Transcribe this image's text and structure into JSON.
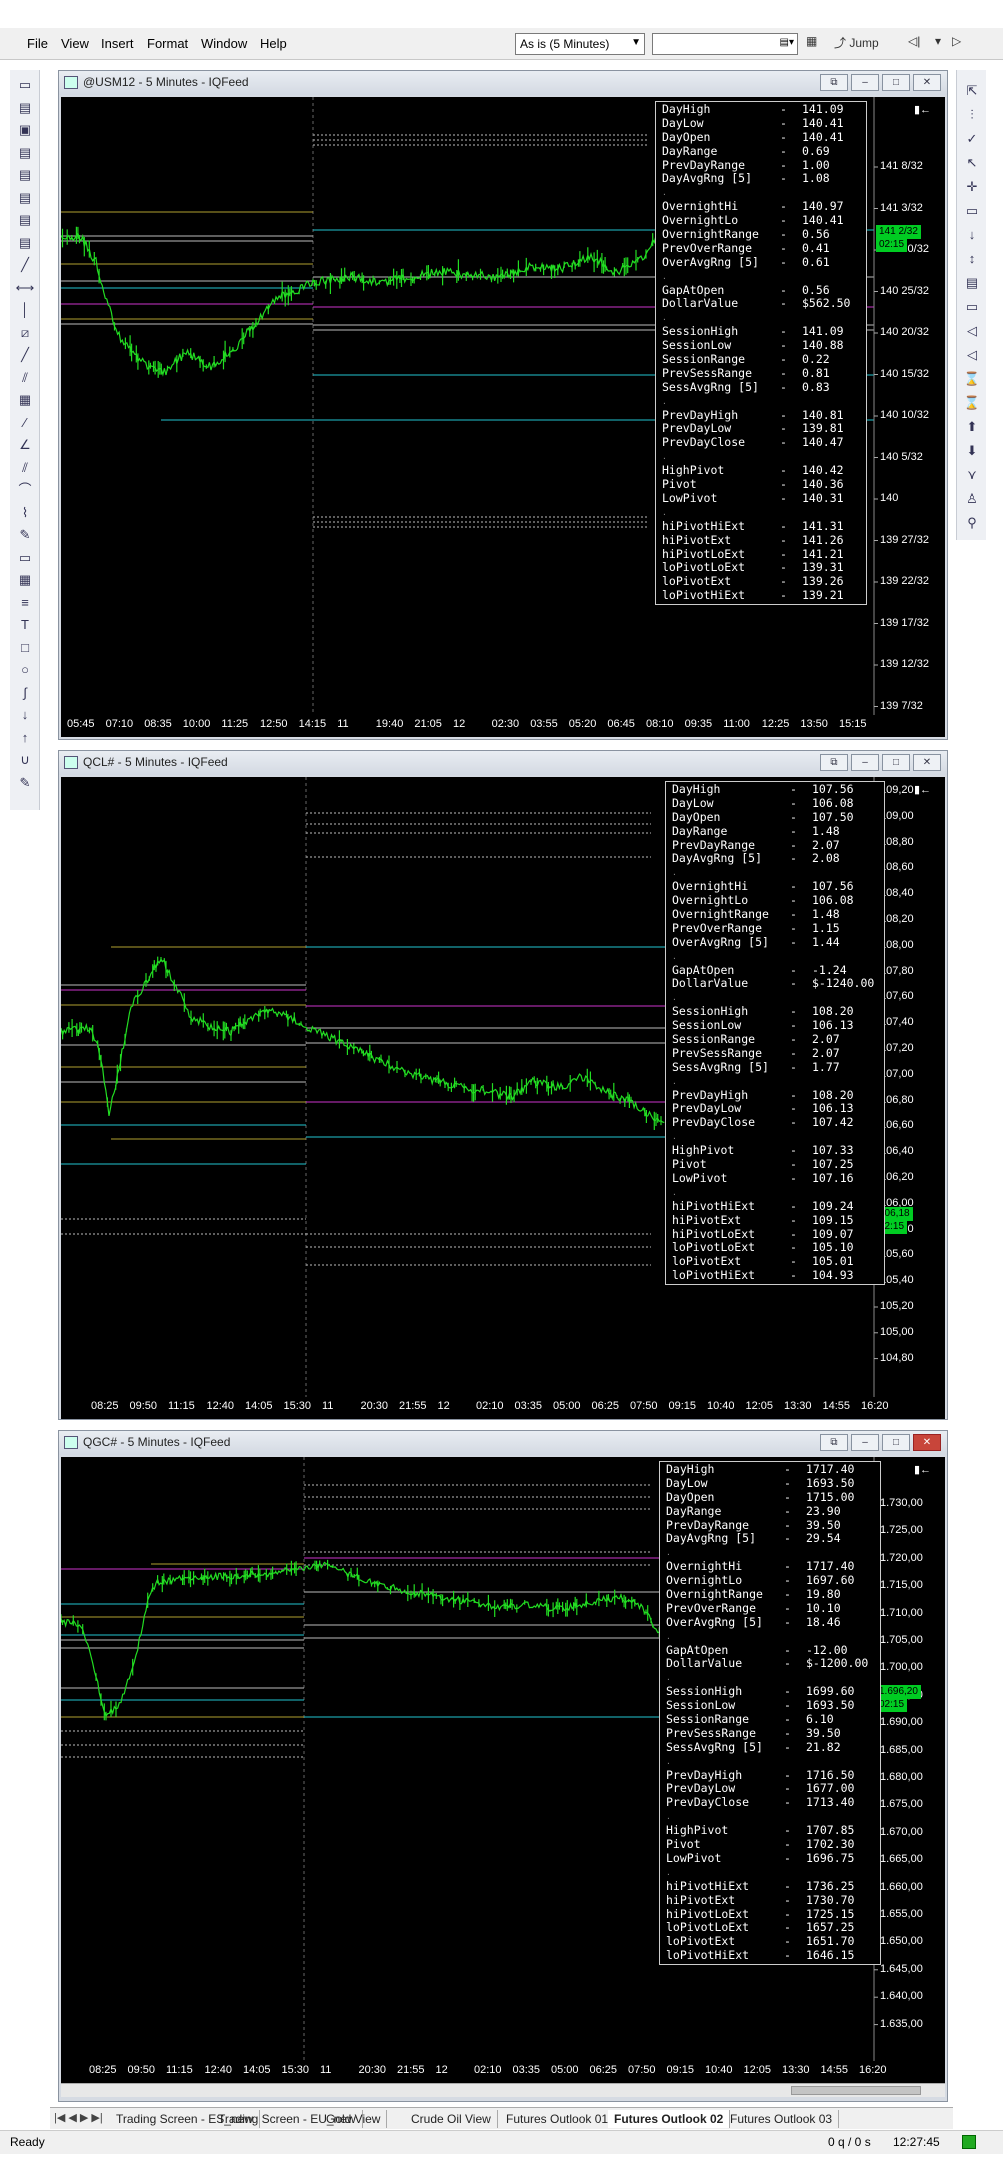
{
  "menu": {
    "items": [
      "File",
      "View",
      "Insert",
      "Format",
      "Window",
      "Help"
    ],
    "interval_select": "As is (5 Minutes)",
    "search_value": "",
    "jump_label": "Jump"
  },
  "charts": [
    {
      "title": "@USM12 - 5 Minutes - IQFeed",
      "x_ticks": [
        "05:45",
        "07:10",
        "08:35",
        "10:00",
        "11:25",
        "12:50",
        "14:15",
        "11",
        "19:40",
        "21:05",
        "12",
        "02:30",
        "03:55",
        "05:20",
        "06:45",
        "08:10",
        "09:35",
        "11:00",
        "12:25",
        "13:50",
        "15:15"
      ],
      "y_ticks": [
        "141 8/32",
        "141 3/32",
        "140 30/32",
        "140 25/32",
        "140 20/32",
        "140 15/32",
        "140 10/32",
        "140 5/32",
        "140",
        "139 27/32",
        "139 22/32",
        "139 17/32",
        "139 12/32",
        "139 7/32"
      ],
      "price_tags": [
        "141 2/32",
        "02:15"
      ],
      "stats": [
        [
          "DayHigh",
          "141.09"
        ],
        [
          "DayLow",
          "140.41"
        ],
        [
          "DayOpen",
          "140.41"
        ],
        [
          "DayRange",
          "0.69"
        ],
        [
          "PrevDayRange",
          "1.00"
        ],
        [
          "DayAvgRng [5]",
          "1.08"
        ],
        null,
        [
          "OvernightHi",
          "140.97"
        ],
        [
          "OvernightLo",
          "140.41"
        ],
        [
          "OvernightRange",
          "0.56"
        ],
        [
          "PrevOverRange",
          "0.41"
        ],
        [
          "OverAvgRng [5]",
          "0.61"
        ],
        null,
        [
          "GapAtOpen",
          "0.56"
        ],
        [
          "DollarValue",
          "$562.50"
        ],
        null,
        [
          "SessionHigh",
          "141.09"
        ],
        [
          "SessionLow",
          "140.88"
        ],
        [
          "SessionRange",
          "0.22"
        ],
        [
          "PrevSessRange",
          "0.81"
        ],
        [
          "SessAvgRng [5]",
          "0.83"
        ],
        null,
        [
          "PrevDayHigh",
          "140.81"
        ],
        [
          "PrevDayLow",
          "139.81"
        ],
        [
          "PrevDayClose",
          "140.47"
        ],
        null,
        [
          "HighPivot",
          "140.42"
        ],
        [
          "Pivot",
          "140.36"
        ],
        [
          "LowPivot",
          "140.31"
        ],
        null,
        [
          "hiPivotHiExt",
          "141.31"
        ],
        [
          "hiPivotExt",
          "141.26"
        ],
        [
          "hiPivotLoExt",
          "141.21"
        ],
        [
          "loPivotLoExt",
          "139.31"
        ],
        [
          "loPivotExt",
          "139.26"
        ],
        [
          "loPivotHiExt",
          "139.21"
        ]
      ]
    },
    {
      "title": "QCL# - 5 Minutes - IQFeed",
      "x_ticks": [
        "08:25",
        "09:50",
        "11:15",
        "12:40",
        "14:05",
        "15:30",
        "11",
        "20:30",
        "21:55",
        "12",
        "02:10",
        "03:35",
        "05:00",
        "06:25",
        "07:50",
        "09:15",
        "10:40",
        "12:05",
        "13:30",
        "14:55",
        "16:20"
      ],
      "y_ticks": [
        "109,20",
        "109,00",
        "108,80",
        "108,60",
        "108,40",
        "108,20",
        "108,00",
        "107,80",
        "107,60",
        "107,40",
        "107,20",
        "107,00",
        "106,80",
        "106,60",
        "106,40",
        "106,20",
        "106,00",
        "105,80",
        "105,60",
        "105,40",
        "105,20",
        "105,00",
        "104,80"
      ],
      "price_tags": [
        "106,18",
        "02:15"
      ],
      "stats": [
        [
          "DayHigh",
          "107.56"
        ],
        [
          "DayLow",
          "106.08"
        ],
        [
          "DayOpen",
          "107.50"
        ],
        [
          "DayRange",
          "1.48"
        ],
        [
          "PrevDayRange",
          "2.07"
        ],
        [
          "DayAvgRng [5]",
          "2.08"
        ],
        null,
        [
          "OvernightHi",
          "107.56"
        ],
        [
          "OvernightLo",
          "106.08"
        ],
        [
          "OvernightRange",
          "1.48"
        ],
        [
          "PrevOverRange",
          "1.15"
        ],
        [
          "OverAvgRng [5]",
          "1.44"
        ],
        null,
        [
          "GapAtOpen",
          "-1.24"
        ],
        [
          "DollarValue",
          "$-1240.00"
        ],
        null,
        [
          "SessionHigh",
          "108.20"
        ],
        [
          "SessionLow",
          "106.13"
        ],
        [
          "SessionRange",
          "2.07"
        ],
        [
          "PrevSessRange",
          "2.07"
        ],
        [
          "SessAvgRng [5]",
          "1.77"
        ],
        null,
        [
          "PrevDayHigh",
          "108.20"
        ],
        [
          "PrevDayLow",
          "106.13"
        ],
        [
          "PrevDayClose",
          "107.42"
        ],
        null,
        [
          "HighPivot",
          "107.33"
        ],
        [
          "Pivot",
          "107.25"
        ],
        [
          "LowPivot",
          "107.16"
        ],
        null,
        [
          "hiPivotHiExt",
          "109.24"
        ],
        [
          "hiPivotExt",
          "109.15"
        ],
        [
          "hiPivotLoExt",
          "109.07"
        ],
        [
          "loPivotLoExt",
          "105.10"
        ],
        [
          "loPivotExt",
          "105.01"
        ],
        [
          "loPivotHiExt",
          "104.93"
        ]
      ]
    },
    {
      "title": "QGC# - 5 Minutes - IQFeed",
      "x_ticks": [
        "08:25",
        "09:50",
        "11:15",
        "12:40",
        "14:05",
        "15:30",
        "11",
        "20:30",
        "21:55",
        "12",
        "02:10",
        "03:35",
        "05:00",
        "06:25",
        "07:50",
        "09:15",
        "10:40",
        "12:05",
        "13:30",
        "14:55",
        "16:20"
      ],
      "y_ticks": [
        "1.730,00",
        "1.725,00",
        "1.720,00",
        "1.715,00",
        "1.710,00",
        "1.705,00",
        "1.700,00",
        "1.695,00",
        "1.690,00",
        "1.685,00",
        "1.680,00",
        "1.675,00",
        "1.670,00",
        "1.665,00",
        "1.660,00",
        "1.655,00",
        "1.650,00",
        "1.645,00",
        "1.640,00",
        "1.635,00"
      ],
      "price_tags": [
        "1.696,20",
        "02:15"
      ],
      "stats": [
        [
          "DayHigh",
          "1717.40"
        ],
        [
          "DayLow",
          "1693.50"
        ],
        [
          "DayOpen",
          "1715.00"
        ],
        [
          "DayRange",
          "23.90"
        ],
        [
          "PrevDayRange",
          "39.50"
        ],
        [
          "DayAvgRng [5]",
          "29.54"
        ],
        null,
        [
          "OvernightHi",
          "1717.40"
        ],
        [
          "OvernightLo",
          "1697.60"
        ],
        [
          "OvernightRange",
          "19.80"
        ],
        [
          "PrevOverRange",
          "10.10"
        ],
        [
          "OverAvgRng [5]",
          "18.46"
        ],
        null,
        [
          "GapAtOpen",
          "-12.00"
        ],
        [
          "DollarValue",
          "$-1200.00"
        ],
        null,
        [
          "SessionHigh",
          "1699.60"
        ],
        [
          "SessionLow",
          "1693.50"
        ],
        [
          "SessionRange",
          "6.10"
        ],
        [
          "PrevSessRange",
          "39.50"
        ],
        [
          "SessAvgRng [5]",
          "21.82"
        ],
        null,
        [
          "PrevDayHigh",
          "1716.50"
        ],
        [
          "PrevDayLow",
          "1677.00"
        ],
        [
          "PrevDayClose",
          "1713.40"
        ],
        null,
        [
          "HighPivot",
          "1707.85"
        ],
        [
          "Pivot",
          "1702.30"
        ],
        [
          "LowPivot",
          "1696.75"
        ],
        null,
        [
          "hiPivotHiExt",
          "1736.25"
        ],
        [
          "hiPivotExt",
          "1730.70"
        ],
        [
          "hiPivotLoExt",
          "1725.15"
        ],
        [
          "loPivotLoExt",
          "1657.25"
        ],
        [
          "loPivotExt",
          "1651.70"
        ],
        [
          "loPivotHiExt",
          "1646.15"
        ]
      ]
    }
  ],
  "tabs": [
    "Trading Screen - ES_new",
    "Trading Screen - EU_new",
    "Gold View",
    "Crude Oil View",
    "Futures Outlook 01",
    "Futures Outlook 02",
    "Futures Outlook 03"
  ],
  "active_tab": "Futures Outlook 02",
  "status": {
    "ready": "Ready",
    "queue": "0 q / 0 s",
    "time": "12:27:45"
  },
  "colors": {
    "price": "#22dd22",
    "magenta": "#cc33cc",
    "cyan": "#22c4d0",
    "olive": "#b0a030",
    "grey": "#bbbbbb"
  }
}
